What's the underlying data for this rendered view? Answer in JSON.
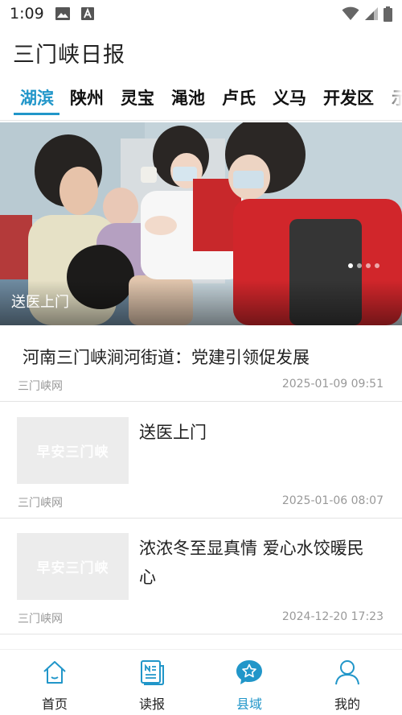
{
  "status_bar": {
    "time": "1:09"
  },
  "app": {
    "title": "三门峡日报"
  },
  "tabs": [
    {
      "label": "湖滨",
      "active": true
    },
    {
      "label": "陕州"
    },
    {
      "label": "灵宝"
    },
    {
      "label": "渑池"
    },
    {
      "label": "卢氏"
    },
    {
      "label": "义马"
    },
    {
      "label": "开发区"
    },
    {
      "label": "示"
    }
  ],
  "banner": {
    "caption": "送医上门",
    "slide_count": 4,
    "active_slide": 1
  },
  "news": [
    {
      "title": "河南三门峡涧河街道：党建引领促发展",
      "source": "三门峡网",
      "time": "2025-01-09 09:51"
    },
    {
      "title": "送医上门",
      "source": "三门峡网",
      "time": "2025-01-06 08:07",
      "thumb_text": "早安三门峡"
    },
    {
      "title": "浓浓冬至显真情 爱心水饺暖民心",
      "source": "三门峡网",
      "time": "2024-12-20 17:23",
      "thumb_text": "早安三门峡"
    }
  ],
  "bottom_nav": [
    {
      "label": "首页",
      "icon": "home-icon"
    },
    {
      "label": "读报",
      "icon": "newspaper-icon"
    },
    {
      "label": "县域",
      "icon": "star-chat-icon",
      "active": true
    },
    {
      "label": "我的",
      "icon": "user-icon"
    }
  ],
  "colors": {
    "accent": "#2196c9",
    "text": "#222222",
    "meta": "#999999"
  }
}
